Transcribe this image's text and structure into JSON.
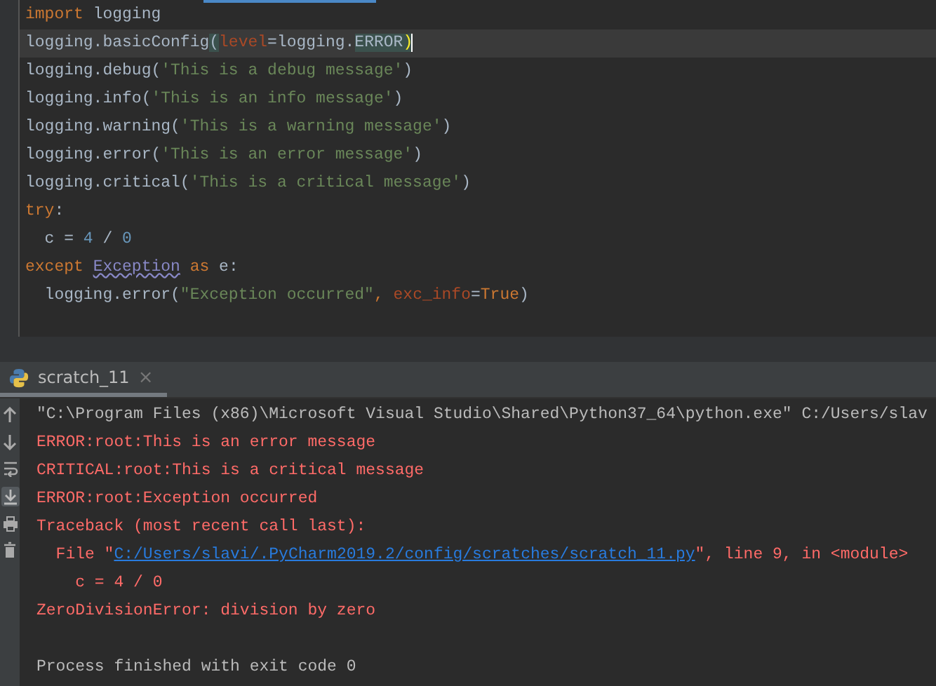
{
  "editor": {
    "lines": [
      {
        "current": false,
        "tokens": [
          {
            "kind": "keyword",
            "text": "import"
          },
          {
            "kind": "text",
            "text": " logging"
          }
        ]
      },
      {
        "current": true,
        "tokens": [
          {
            "kind": "text",
            "text": "logging.basicConfig"
          },
          {
            "kind": "matched",
            "text": "("
          },
          {
            "kind": "param",
            "text": "level"
          },
          {
            "kind": "text",
            "text": "=logging."
          },
          {
            "kind": "matched",
            "text": "ERROR"
          },
          {
            "kind": "matched",
            "text": ")"
          }
        ]
      },
      {
        "current": false,
        "tokens": [
          {
            "kind": "text",
            "text": "logging.debug("
          },
          {
            "kind": "string",
            "text": "'This is a debug message'"
          },
          {
            "kind": "text",
            "text": ")"
          }
        ]
      },
      {
        "current": false,
        "tokens": [
          {
            "kind": "text",
            "text": "logging.info("
          },
          {
            "kind": "string",
            "text": "'This is an info message'"
          },
          {
            "kind": "text",
            "text": ")"
          }
        ]
      },
      {
        "current": false,
        "tokens": [
          {
            "kind": "text",
            "text": "logging.warning("
          },
          {
            "kind": "string",
            "text": "'This is a warning message'"
          },
          {
            "kind": "text",
            "text": ")"
          }
        ]
      },
      {
        "current": false,
        "tokens": [
          {
            "kind": "text",
            "text": "logging.error("
          },
          {
            "kind": "string",
            "text": "'This is an error message'"
          },
          {
            "kind": "text",
            "text": ")"
          }
        ]
      },
      {
        "current": false,
        "tokens": [
          {
            "kind": "text",
            "text": "logging.critical("
          },
          {
            "kind": "string",
            "text": "'This is a critical message'"
          },
          {
            "kind": "text",
            "text": ")"
          }
        ]
      },
      {
        "current": false,
        "tokens": [
          {
            "kind": "keyword",
            "text": "try"
          },
          {
            "kind": "text",
            "text": ":"
          }
        ]
      },
      {
        "current": false,
        "tokens": [
          {
            "kind": "text",
            "text": "  c = "
          },
          {
            "kind": "number",
            "text": "4"
          },
          {
            "kind": "text",
            "text": " / "
          },
          {
            "kind": "number",
            "text": "0"
          }
        ]
      },
      {
        "current": false,
        "tokens": [
          {
            "kind": "keyword",
            "text": "except "
          },
          {
            "kind": "warned",
            "text": "Exception"
          },
          {
            "kind": "keyword",
            "text": " as"
          },
          {
            "kind": "text",
            "text": " e:"
          }
        ]
      },
      {
        "current": false,
        "tokens": [
          {
            "kind": "text",
            "text": "  logging.error("
          },
          {
            "kind": "string",
            "text": "\"Exception occurred\""
          },
          {
            "kind": "keyword",
            "text": ", "
          },
          {
            "kind": "param",
            "text": "exc_info"
          },
          {
            "kind": "text",
            "text": "="
          },
          {
            "kind": "keyword",
            "text": "True"
          },
          {
            "kind": "text",
            "text": ")"
          }
        ]
      }
    ]
  },
  "run_panel": {
    "tab": {
      "label": "scratch_11",
      "close": "×",
      "selected": true
    },
    "output": [
      {
        "kind": "command",
        "parts": [
          {
            "kind": "text",
            "text": "\"C:\\Program Files (x86)\\Microsoft Visual Studio\\Shared\\Python37_64\\python.exe\" C:/Users/slav"
          }
        ]
      },
      {
        "kind": "error",
        "parts": [
          {
            "kind": "text",
            "text": "ERROR:root:This is an error message"
          }
        ]
      },
      {
        "kind": "error",
        "parts": [
          {
            "kind": "text",
            "text": "CRITICAL:root:This is a critical message"
          }
        ]
      },
      {
        "kind": "error",
        "parts": [
          {
            "kind": "text",
            "text": "ERROR:root:Exception occurred"
          }
        ]
      },
      {
        "kind": "error",
        "parts": [
          {
            "kind": "text",
            "text": "Traceback (most recent call last):"
          }
        ]
      },
      {
        "kind": "error",
        "parts": [
          {
            "kind": "text",
            "text": "  File \""
          },
          {
            "kind": "link",
            "text": "C:/Users/slavi/.PyCharm2019.2/config/scratches/scratch_11.py"
          },
          {
            "kind": "text",
            "text": "\", line 9, in <module>"
          }
        ]
      },
      {
        "kind": "error",
        "parts": [
          {
            "kind": "text",
            "text": "    c = 4 / 0"
          }
        ]
      },
      {
        "kind": "error",
        "parts": [
          {
            "kind": "text",
            "text": "ZeroDivisionError: division by zero"
          }
        ]
      },
      {
        "kind": "blank"
      },
      {
        "kind": "command",
        "parts": [
          {
            "kind": "text",
            "text": "Process finished with exit code 0"
          }
        ]
      }
    ]
  }
}
